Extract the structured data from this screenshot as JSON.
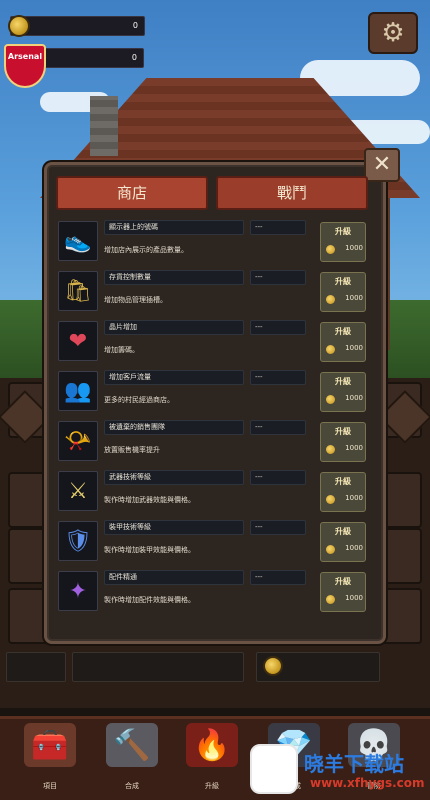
{
  "hud": {
    "gold_value": "0",
    "gem_value": "0",
    "crest_label": "Arsenal",
    "settings_icon": "gear-icon"
  },
  "panel": {
    "close_icon": "close-icon",
    "tabs": [
      {
        "label": "商店",
        "active": true
      },
      {
        "label": "戰鬥",
        "active": false
      }
    ],
    "upgrade_label": "升級",
    "items": [
      {
        "name": "顯示器上的號碼",
        "value": "---",
        "desc": "增加店內展示的產品數量。",
        "cost": "1000",
        "icon": "shoes-icon",
        "glyph": "👟",
        "color": "#7fb6d8"
      },
      {
        "name": "存貨控制數量",
        "value": "---",
        "desc": "增加物品管理插槽。",
        "cost": "1000",
        "icon": "storage-bag-icon",
        "glyph": "🛍",
        "color": "#d9b44a"
      },
      {
        "name": "晶片增加",
        "value": "---",
        "desc": "增加籌碼。",
        "cost": "1000",
        "icon": "heart-icon",
        "glyph": "❤",
        "color": "#e0485a"
      },
      {
        "name": "增加客戶流量",
        "value": "---",
        "desc": "更多的村民經過商店。",
        "cost": "1000",
        "icon": "crowd-icon",
        "glyph": "👥",
        "color": "#e8b640"
      },
      {
        "name": "被遺棄的銷售團隊",
        "value": "---",
        "desc": "放置販售機率提升",
        "cost": "1000",
        "icon": "trumpet-icon",
        "glyph": "📯",
        "color": "#e8c450"
      },
      {
        "name": "武器技術等級",
        "value": "---",
        "desc": "製作時增加武器效能與價格。",
        "cost": "1000",
        "icon": "sword-icon",
        "glyph": "⚔",
        "color": "#e8d070"
      },
      {
        "name": "裝甲技術等級",
        "value": "---",
        "desc": "製作時增加裝甲效能與價格。",
        "cost": "1000",
        "icon": "armor-icon",
        "glyph": "🛡",
        "color": "#5a8ee8"
      },
      {
        "name": "配件精通",
        "value": "---",
        "desc": "製作時增加配件效能與價格。",
        "cost": "1000",
        "icon": "accessory-icon",
        "glyph": "✦",
        "color": "#a060e0"
      }
    ]
  },
  "nav": {
    "items": [
      {
        "label": "項目",
        "icon": "chest-icon",
        "glyph": "🧰"
      },
      {
        "label": "合成",
        "icon": "hammer-icon",
        "glyph": "🔨"
      },
      {
        "label": "升級",
        "icon": "fire-orb-icon",
        "glyph": "🔥"
      },
      {
        "label": "組成",
        "icon": "ore-icon",
        "glyph": "💎"
      },
      {
        "label": "冒險",
        "icon": "skull-helmet-icon",
        "glyph": "💀"
      }
    ]
  },
  "watermark": {
    "text": "晓羊下载站",
    "url": "www.xfhygs.com"
  }
}
